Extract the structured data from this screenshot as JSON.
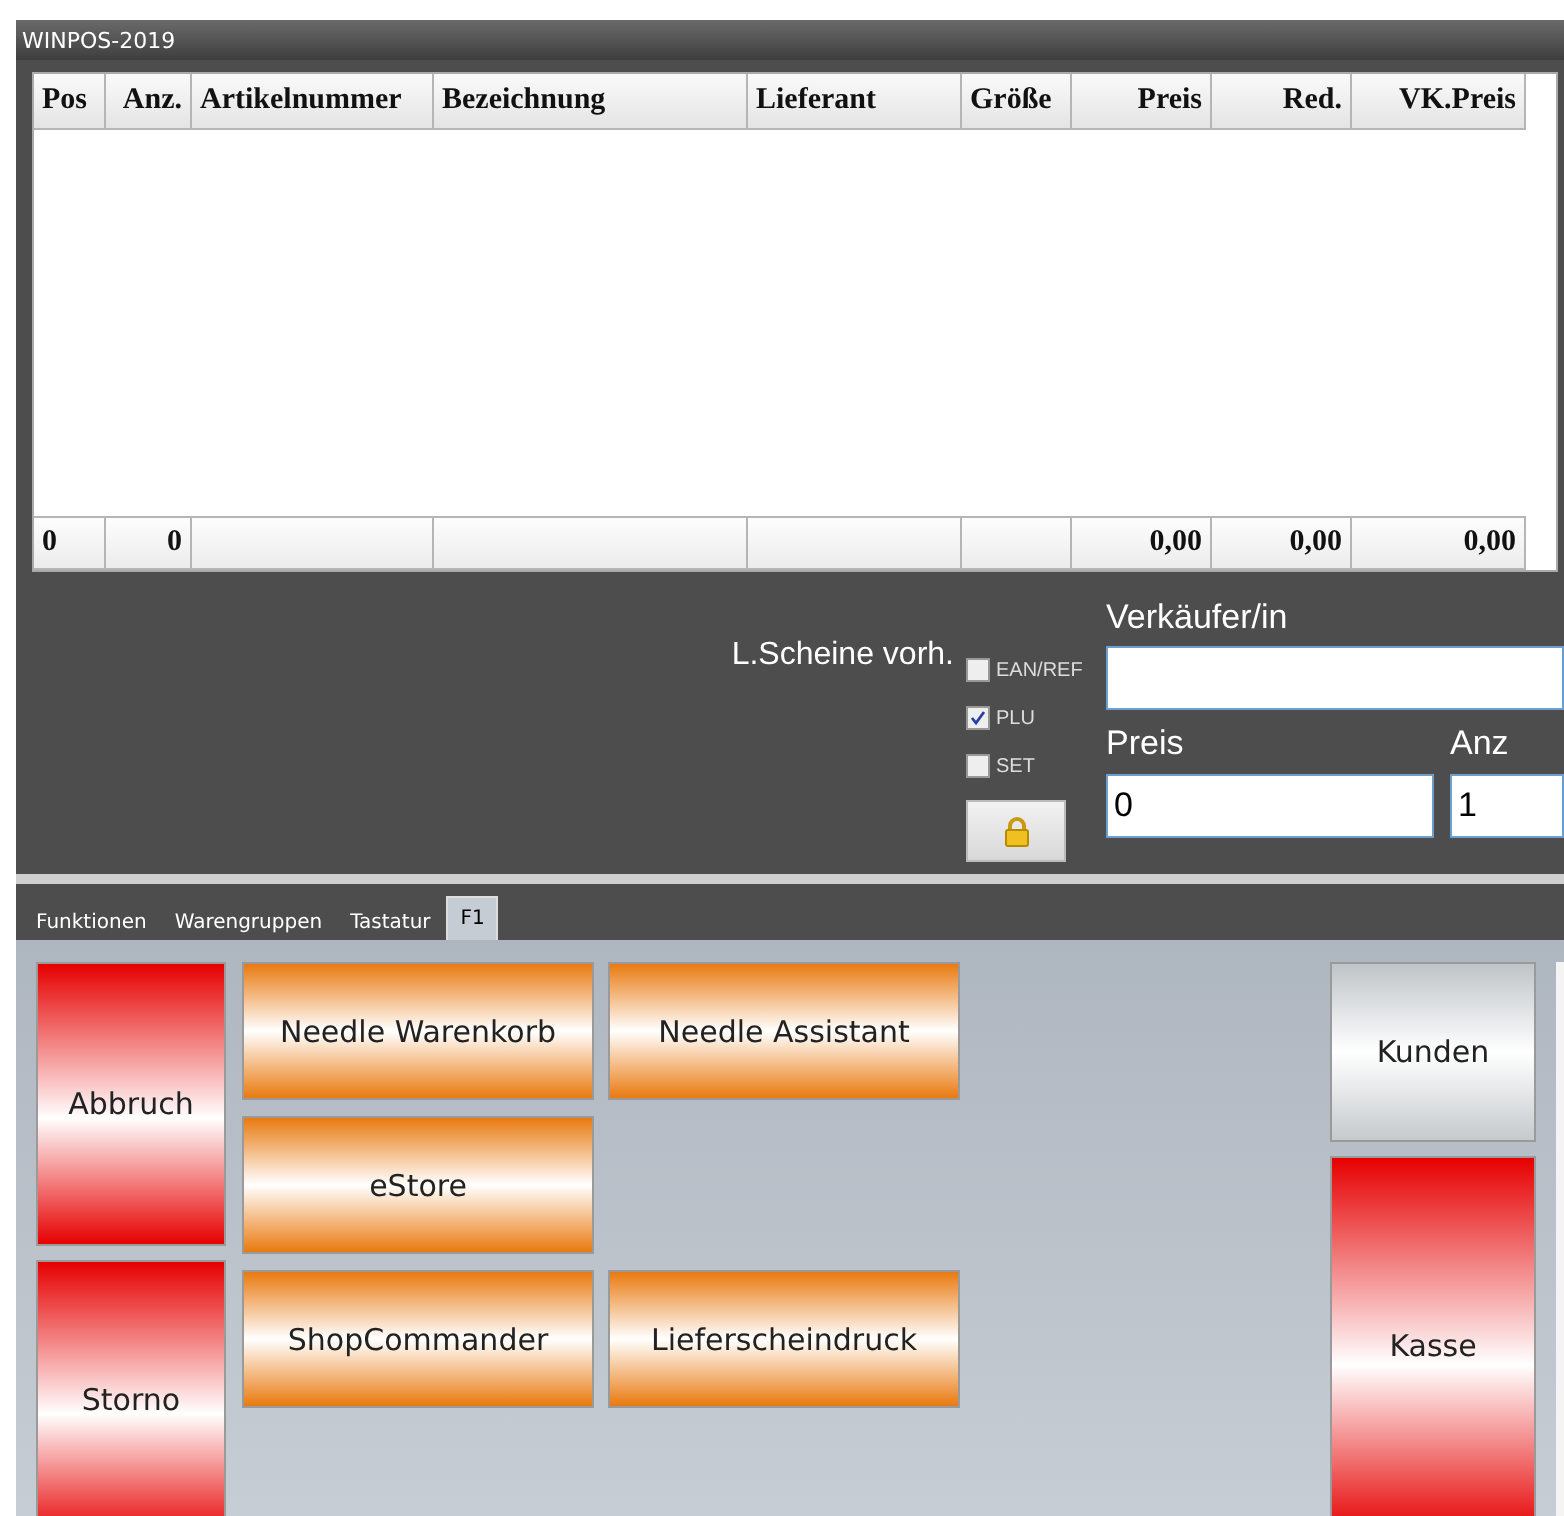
{
  "window": {
    "title": "WINPOS-2019"
  },
  "table": {
    "columns": [
      {
        "label": "Pos",
        "kind": "text",
        "total": "0"
      },
      {
        "label": "Anz.",
        "kind": "number",
        "total": "0"
      },
      {
        "label": "Artikelnummer",
        "kind": "text"
      },
      {
        "label": "Bezeichnung",
        "kind": "text"
      },
      {
        "label": "Lieferant",
        "kind": "text"
      },
      {
        "label": "Größe",
        "kind": "text"
      },
      {
        "label": "Preis",
        "kind": "number",
        "total": "0,00"
      },
      {
        "label": "Red.",
        "kind": "number",
        "total": "0,00"
      },
      {
        "label": "VK.Preis",
        "kind": "number",
        "total": "0,00"
      }
    ]
  },
  "entry": {
    "note": "L.Scheine vorh.",
    "modes": [
      {
        "label": "EAN/REF",
        "checked": false
      },
      {
        "label": "PLU",
        "checked": true
      },
      {
        "label": "SET",
        "checked": false
      }
    ],
    "seller": {
      "label": "Verkäufer/in"
    },
    "price": {
      "label": "Preis",
      "value": "0"
    },
    "quantity": {
      "label": "Anz",
      "value": "1"
    }
  },
  "tabs": [
    {
      "label": "Funktionen",
      "selected": false
    },
    {
      "label": "Warengruppen",
      "selected": false
    },
    {
      "label": "Tastatur",
      "selected": false
    },
    {
      "label": "F1",
      "selected": true
    }
  ],
  "left_buttons": [
    {
      "label": "Abbruch",
      "kind": "red"
    },
    {
      "label": "Storno",
      "kind": "red"
    }
  ],
  "function_rows": [
    [
      {
        "label": "Needle Warenkorb",
        "kind": "orange"
      },
      {
        "label": "Needle Assistant",
        "kind": "orange"
      }
    ],
    [
      {
        "label": "eStore",
        "kind": "orange"
      }
    ],
    [
      {
        "label": "ShopCommander",
        "kind": "orange"
      },
      {
        "label": "Lieferscheindruck",
        "kind": "orange"
      }
    ]
  ],
  "right_buttons": [
    {
      "label": "Kunden",
      "kind": "grey"
    },
    {
      "label": "Kasse",
      "kind": "red"
    }
  ]
}
